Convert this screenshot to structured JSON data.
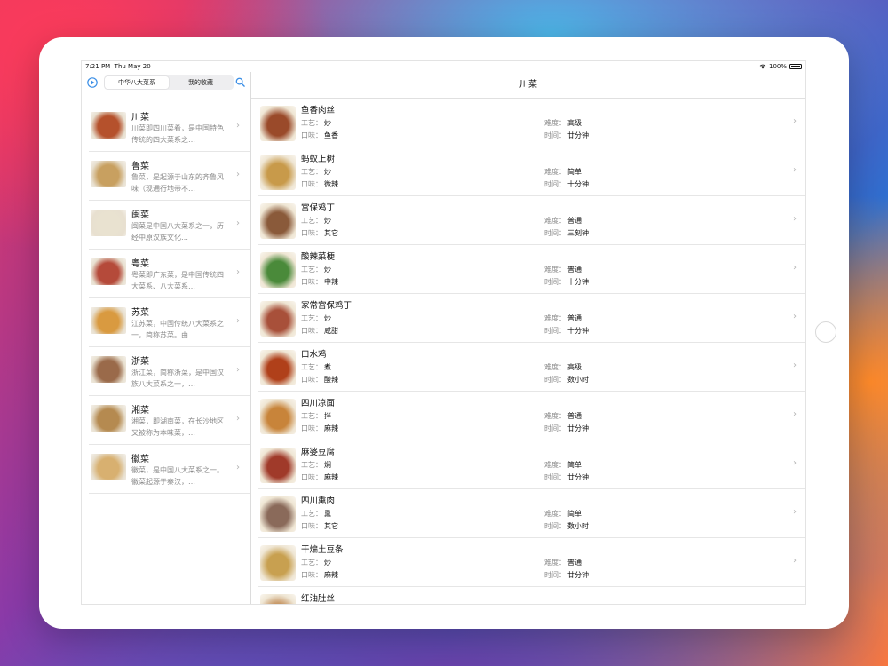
{
  "status_bar": {
    "time": "7:21 PM",
    "date": "Thu May 20",
    "battery": "100%"
  },
  "sidebar": {
    "segments": [
      {
        "label": "中华八大菜系",
        "active": true
      },
      {
        "label": "我的收藏",
        "active": false
      }
    ],
    "categories": [
      {
        "title": "川菜",
        "desc": "川菜即四川菜肴，是中国特色传统的四大菜系之…",
        "thumb_color": "#b5512c"
      },
      {
        "title": "鲁菜",
        "desc": "鲁菜，是起源于山东的齐鲁风味（现通行地带不…",
        "thumb_color": "#c8a060"
      },
      {
        "title": "闽菜",
        "desc": "闽菜是中国八大菜系之一，历经中原汉族文化…",
        "thumb_color": "#e9e2d0"
      },
      {
        "title": "粤菜",
        "desc": "粤菜即广东菜，是中国传统四大菜系、八大菜系…",
        "thumb_color": "#b54a3a"
      },
      {
        "title": "苏菜",
        "desc": "江苏菜，中国传统八大菜系之一，简称苏菜。由…",
        "thumb_color": "#d99a40"
      },
      {
        "title": "浙菜",
        "desc": "浙江菜，简称浙菜，是中国汉族八大菜系之一，…",
        "thumb_color": "#9a6a4a"
      },
      {
        "title": "湘菜",
        "desc": "湘菜，即湖南菜，在长沙地区又被称为本味菜，…",
        "thumb_color": "#b58a50"
      },
      {
        "title": "徽菜",
        "desc": "徽菜，是中国八大菜系之一。徽菜起源于秦汉，…",
        "thumb_color": "#d8b070"
      }
    ]
  },
  "detail": {
    "title": "川菜",
    "labels": {
      "craft": "工艺：",
      "taste": "口味：",
      "difficulty": "难度：",
      "time": "时间："
    },
    "dishes": [
      {
        "name": "鱼香肉丝",
        "craft": "炒",
        "taste": "鱼香",
        "difficulty": "高级",
        "time": "廿分钟",
        "thumb_color": "#9a4a2a"
      },
      {
        "name": "蚂蚁上树",
        "craft": "炒",
        "taste": "微辣",
        "difficulty": "简单",
        "time": "十分钟",
        "thumb_color": "#c89a4a"
      },
      {
        "name": "宫保鸡丁",
        "craft": "炒",
        "taste": "其它",
        "difficulty": "普通",
        "time": "三刻钟",
        "thumb_color": "#8a5a3a"
      },
      {
        "name": "酸辣菜梗",
        "craft": "炒",
        "taste": "中辣",
        "difficulty": "普通",
        "time": "十分钟",
        "thumb_color": "#4a8a3a"
      },
      {
        "name": "家常宫保鸡丁",
        "craft": "炒",
        "taste": "咸甜",
        "difficulty": "普通",
        "time": "十分钟",
        "thumb_color": "#a8503a"
      },
      {
        "name": "口水鸡",
        "craft": "煮",
        "taste": "酸辣",
        "difficulty": "高级",
        "time": "数小时",
        "thumb_color": "#b0401a"
      },
      {
        "name": "四川凉面",
        "craft": "拌",
        "taste": "麻辣",
        "difficulty": "普通",
        "time": "廿分钟",
        "thumb_color": "#c8843a"
      },
      {
        "name": "麻婆豆腐",
        "craft": "焖",
        "taste": "麻辣",
        "difficulty": "简单",
        "time": "廿分钟",
        "thumb_color": "#a03a2a"
      },
      {
        "name": "四川熏肉",
        "craft": "熏",
        "taste": "其它",
        "difficulty": "简单",
        "time": "数小时",
        "thumb_color": "#8a6a5a"
      },
      {
        "name": "干煸土豆条",
        "craft": "炒",
        "taste": "麻辣",
        "difficulty": "普通",
        "time": "廿分钟",
        "thumb_color": "#c8a050"
      },
      {
        "name": "红油肚丝",
        "craft": "",
        "taste": "",
        "difficulty": "",
        "time": "",
        "thumb_color": "#c89a6a"
      }
    ]
  },
  "icons": {
    "play": "play-circle-icon",
    "search": "search-icon",
    "chevron": "chevron-right-icon",
    "wifi": "wifi-icon",
    "battery": "battery-icon"
  },
  "colors": {
    "accent": "#3a8ee6"
  }
}
